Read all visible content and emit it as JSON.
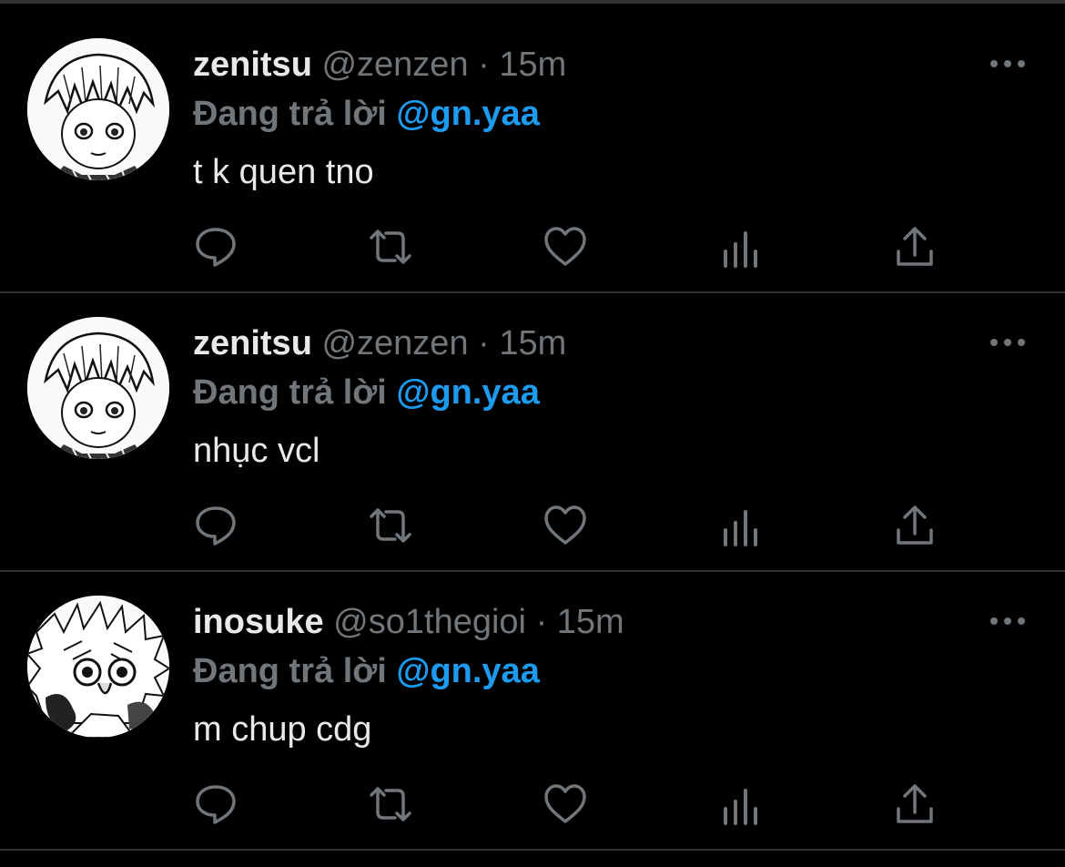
{
  "colors": {
    "background": "#000000",
    "text_primary": "#e7e9ea",
    "text_secondary": "#71767b",
    "accent": "#1d9bf0",
    "divider": "#2f3336"
  },
  "icons": [
    "reply-icon",
    "retweet-icon",
    "like-icon",
    "analytics-icon",
    "share-icon",
    "more-icon"
  ],
  "tweets": [
    {
      "display_name": "zenitsu",
      "handle": "@zenzen",
      "separator": "·",
      "time": "15m",
      "reply_prefix": "Đang trả lời",
      "reply_target": "@gn.yaa",
      "text": "t k quen tno",
      "avatar_icon": "zenitsu-avatar"
    },
    {
      "display_name": "zenitsu",
      "handle": "@zenzen",
      "separator": "·",
      "time": "15m",
      "reply_prefix": "Đang trả lời",
      "reply_target": "@gn.yaa",
      "text": "nhục vcl",
      "avatar_icon": "zenitsu-avatar"
    },
    {
      "display_name": "inosuke",
      "handle": "@so1thegioi",
      "separator": "·",
      "time": "15m",
      "reply_prefix": "Đang trả lời",
      "reply_target": "@gn.yaa",
      "text": "m chup cdg",
      "avatar_icon": "inosuke-avatar"
    }
  ]
}
